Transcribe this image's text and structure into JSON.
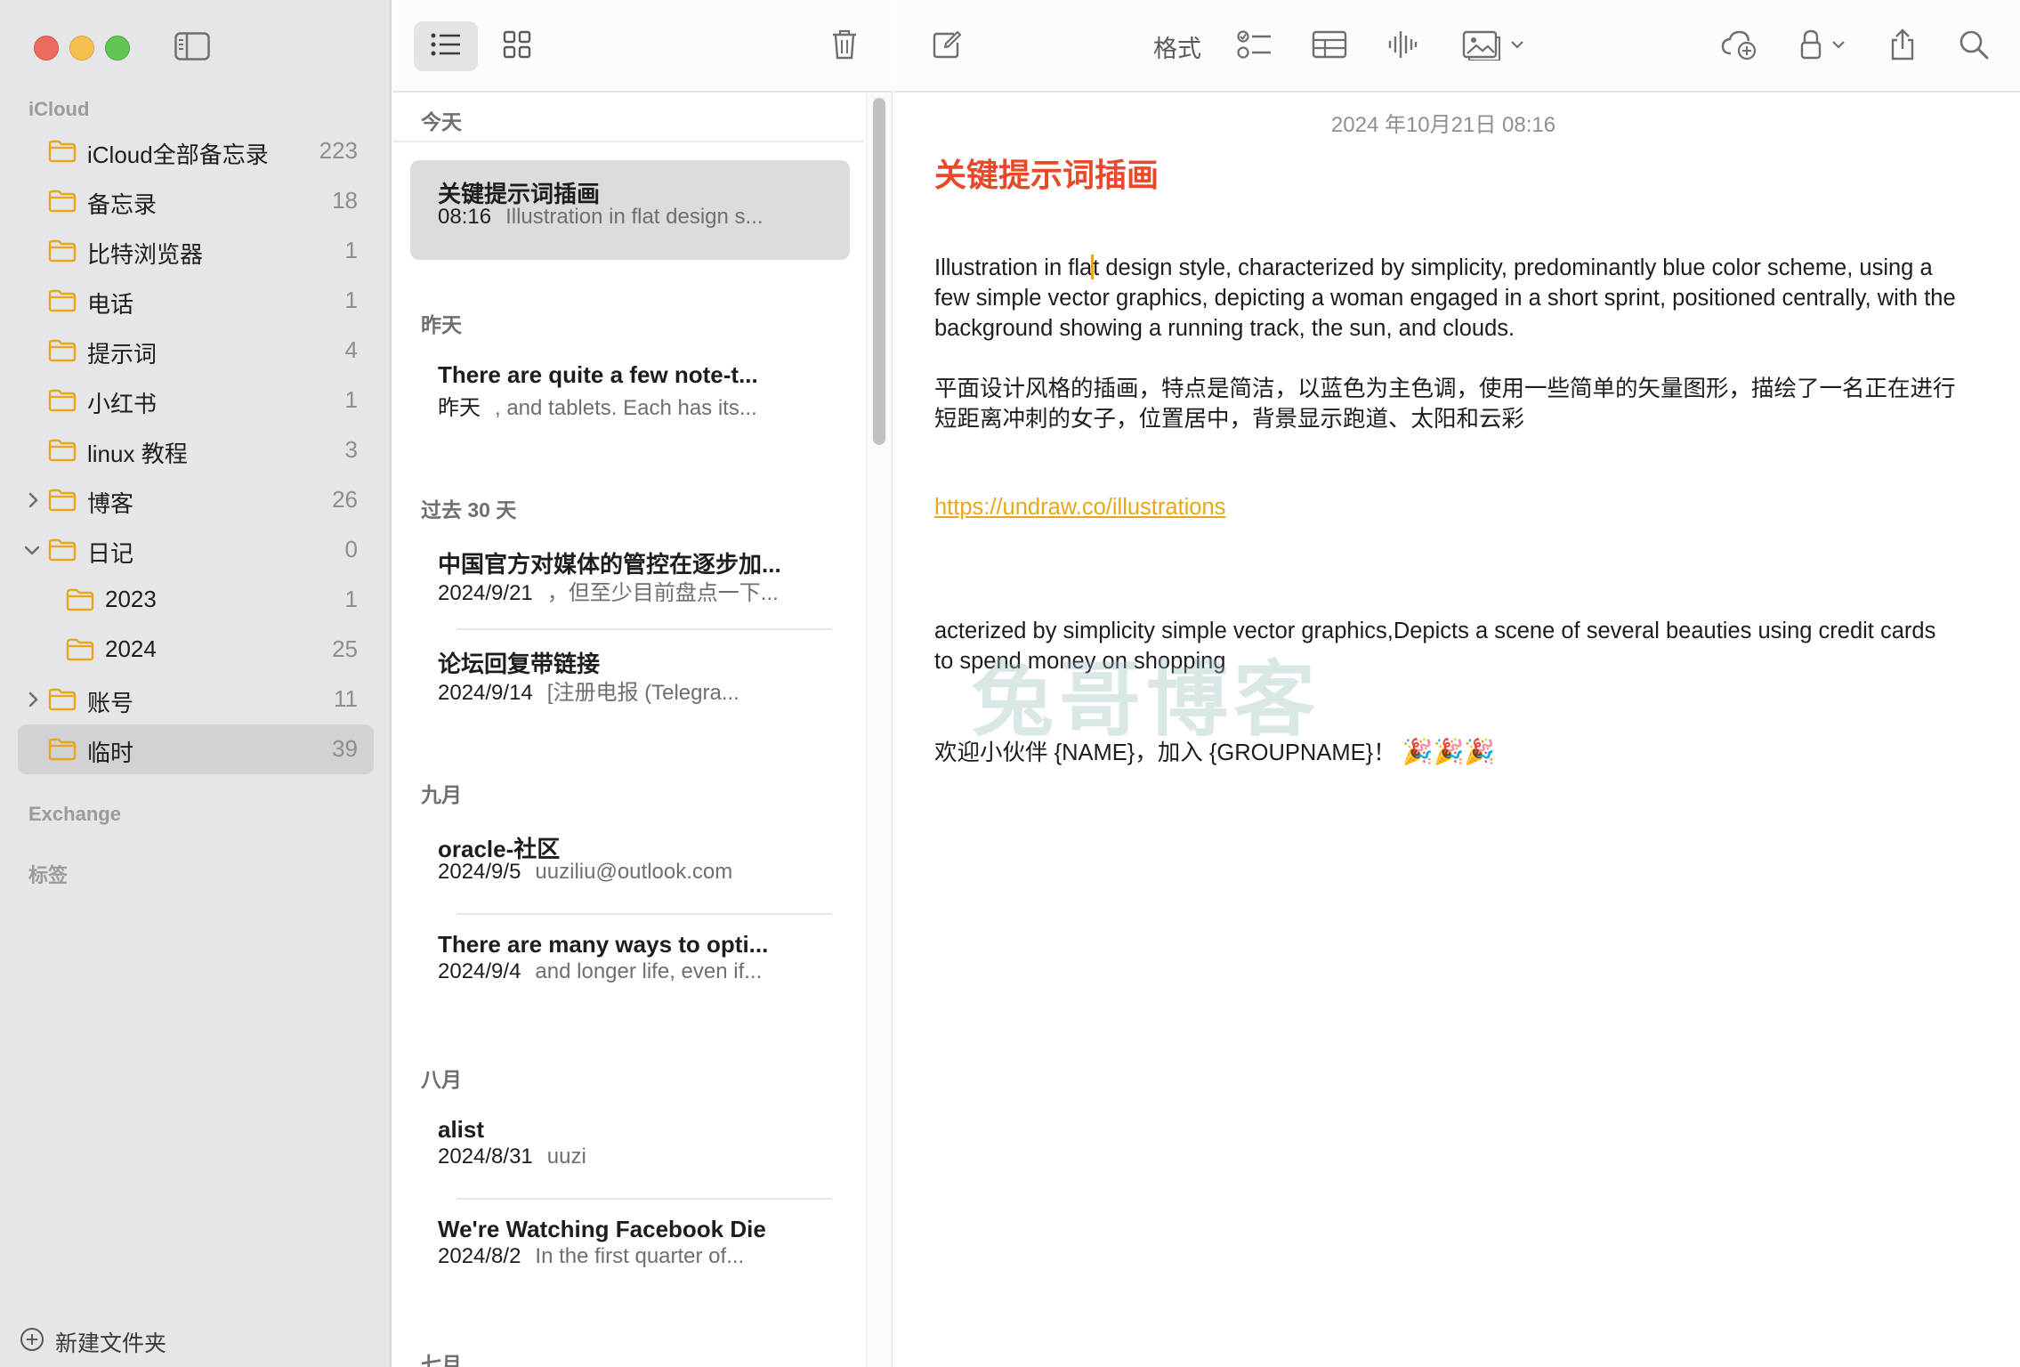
{
  "sidebar": {
    "account": "iCloud",
    "folders": [
      {
        "label": "iCloud全部备忘录",
        "count": "223"
      },
      {
        "label": "备忘录",
        "count": "18"
      },
      {
        "label": "比特浏览器",
        "count": "1"
      },
      {
        "label": "电话",
        "count": "1"
      },
      {
        "label": "提示词",
        "count": "4"
      },
      {
        "label": "小红书",
        "count": "1"
      },
      {
        "label": "linux 教程",
        "count": "3"
      },
      {
        "label": "博客",
        "count": "26"
      },
      {
        "label": "日记",
        "count": "0"
      },
      {
        "label": "2023",
        "count": "1"
      },
      {
        "label": "2024",
        "count": "25"
      },
      {
        "label": "账号",
        "count": "11"
      },
      {
        "label": "临时",
        "count": "39"
      }
    ],
    "exchange": "Exchange",
    "tags": "标签",
    "new_folder": "新建文件夹"
  },
  "note_list": {
    "groups": [
      "今天",
      "昨天",
      "过去 30 天",
      "九月",
      "八月",
      "七月"
    ],
    "notes": [
      {
        "title": "关键提示词插画",
        "date": "08:16",
        "preview": "Illustration in flat design s..."
      },
      {
        "title": "There are quite a few note-t...",
        "date": "昨天",
        "preview": ", and tablets. Each has its..."
      },
      {
        "title": "中国官方对媒体的管控在逐步加...",
        "date": "2024/9/21",
        "preview": "，但至少目前盘点一下..."
      },
      {
        "title": "论坛回复带链接",
        "date": "2024/9/14",
        "preview": "[注册电报 (Telegra..."
      },
      {
        "title": "oracle-社区",
        "date": "2024/9/5",
        "preview": "uuziliu@outlook.com"
      },
      {
        "title": "There are many ways to opti...",
        "date": "2024/9/4",
        "preview": "and longer life, even if..."
      },
      {
        "title": "alist",
        "date": "2024/8/31",
        "preview": "uuzi"
      },
      {
        "title": "We're Watching Facebook Die",
        "date": "2024/8/2",
        "preview": "In the first quarter of..."
      }
    ]
  },
  "editor": {
    "toolbar": {
      "format": "格式"
    },
    "date": "2024 年10月21日 08:16",
    "title": "关键提示词插画",
    "para1_a": "Illustration in fla",
    "para1_b": "t design style, characterized by simplicity, predominantly blue color scheme, using a few simple vector graphics, depicting a woman engaged in a short sprint, positioned centrally, with the background showing a running track, the sun, and clouds.",
    "para2": "平面设计风格的插画，特点是简洁，以蓝色为主色调，使用一些简单的矢量图形，描绘了一名正在进行短距离冲刺的女子，位置居中，背景显示跑道、太阳和云彩",
    "link": "https://undraw.co/illustrations",
    "para3": "acterized by simplicity simple vector graphics,Depicts a scene of several beauties using credit cards to spend money on shopping",
    "para4": "欢迎小伙伴 {NAME}，加入 {GROUPNAME}！",
    "emoji": "🎉🎉🎉",
    "watermark": "兔哥博客"
  },
  "colors": {
    "accent": "#e6a819",
    "title": "#e8492a",
    "folder": "#e6a819"
  }
}
